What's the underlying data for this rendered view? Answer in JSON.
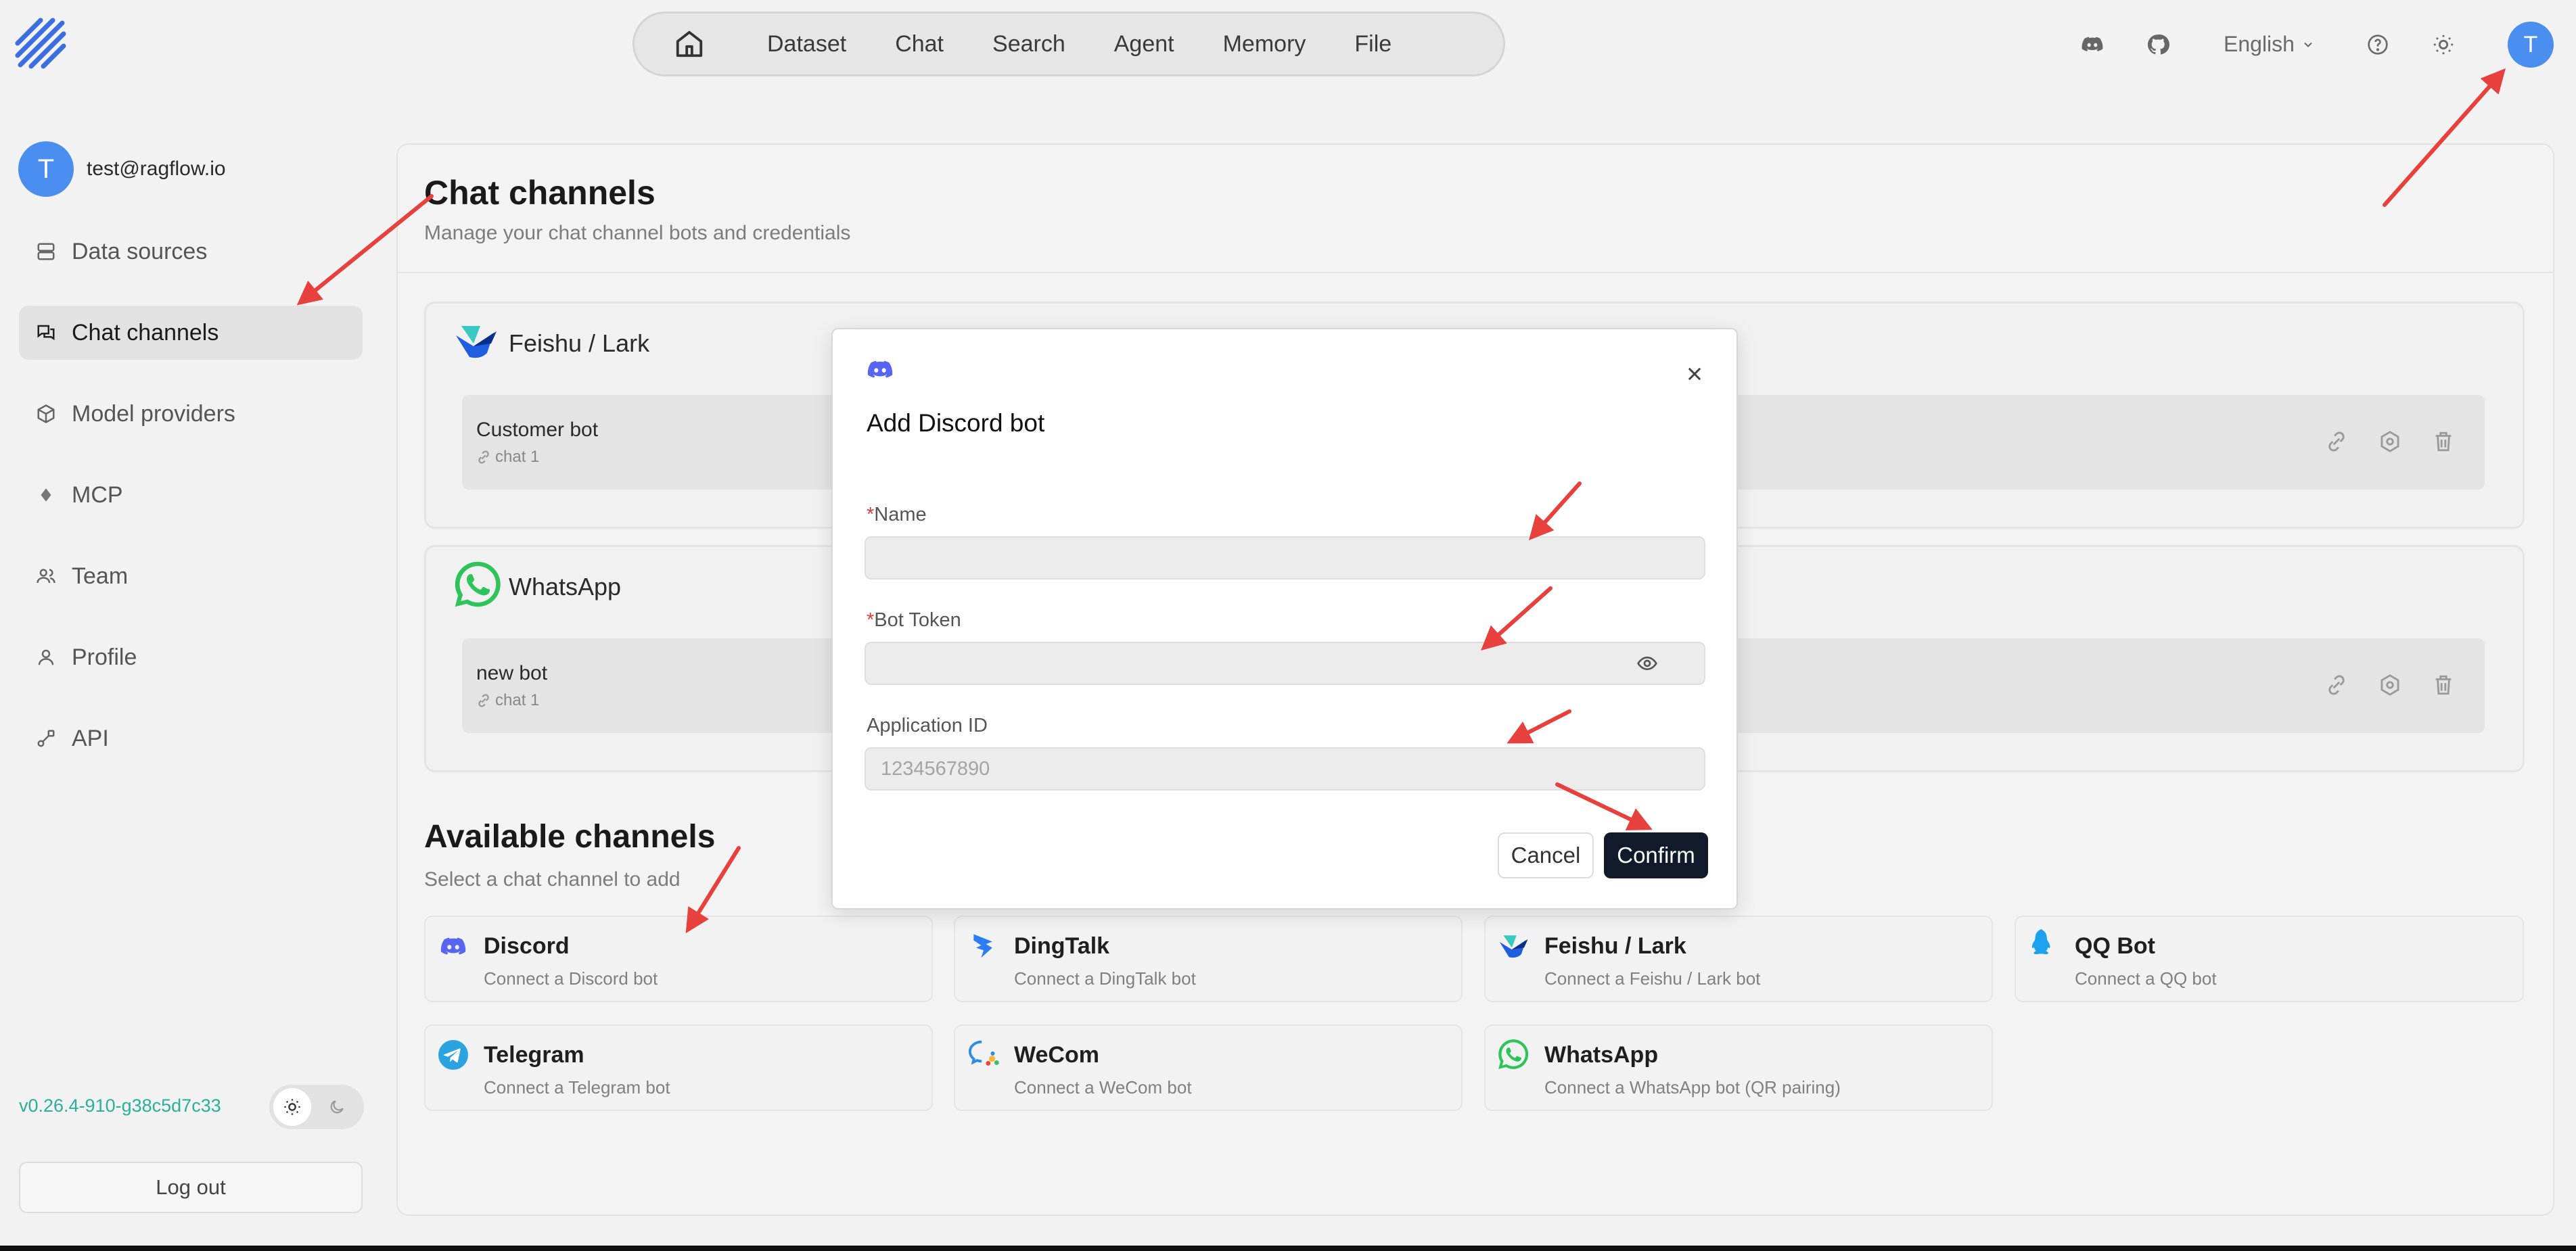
{
  "nav": {
    "items": [
      "Dataset",
      "Chat",
      "Search",
      "Agent",
      "Memory",
      "File"
    ],
    "language": "English",
    "avatar_letter": "T"
  },
  "sidebar": {
    "avatar_letter": "T",
    "email": "test@ragflow.io",
    "items": [
      {
        "label": "Data sources",
        "icon": "data-sources-icon"
      },
      {
        "label": "Chat channels",
        "icon": "chat-channels-icon",
        "active": true
      },
      {
        "label": "Model providers",
        "icon": "box-icon"
      },
      {
        "label": "MCP",
        "icon": "mcp-icon"
      },
      {
        "label": "Team",
        "icon": "team-icon"
      },
      {
        "label": "Profile",
        "icon": "profile-icon"
      },
      {
        "label": "API",
        "icon": "api-icon"
      }
    ],
    "version": "v0.26.4-910-g38c5d7c33",
    "logout": "Log out"
  },
  "main": {
    "title": "Chat channels",
    "subtitle": "Manage your chat channel bots and credentials",
    "configured": [
      {
        "platform": "Feishu / Lark",
        "bot_name": "Customer bot",
        "bot_chat": "chat 1"
      },
      {
        "platform": "WhatsApp",
        "bot_name": "new bot",
        "bot_chat": "chat 1"
      }
    ],
    "available_title": "Available channels",
    "available_subtitle": "Select a chat channel to add",
    "available": [
      {
        "name": "Discord",
        "desc": "Connect a Discord bot"
      },
      {
        "name": "DingTalk",
        "desc": "Connect a DingTalk bot"
      },
      {
        "name": "Feishu / Lark",
        "desc": "Connect a Feishu / Lark bot"
      },
      {
        "name": "QQ Bot",
        "desc": "Connect a QQ bot"
      },
      {
        "name": "Telegram",
        "desc": "Connect a Telegram bot"
      },
      {
        "name": "WeCom",
        "desc": "Connect a WeCom bot"
      },
      {
        "name": "WhatsApp",
        "desc": "Connect a WhatsApp bot (QR pairing)"
      }
    ]
  },
  "dialog": {
    "title": "Add Discord bot",
    "fields": {
      "name_label": "Name",
      "name_value": "",
      "token_label": "Bot Token",
      "token_value": "",
      "appid_label": "Application ID",
      "appid_placeholder": "1234567890"
    },
    "required_mark": "*",
    "cancel": "Cancel",
    "confirm": "Confirm"
  },
  "colors": {
    "accent": "#4a8ef0",
    "confirm_bg": "#111a2a",
    "annotation_arrow": "#e8403c",
    "version_text": "#2ab09a"
  }
}
